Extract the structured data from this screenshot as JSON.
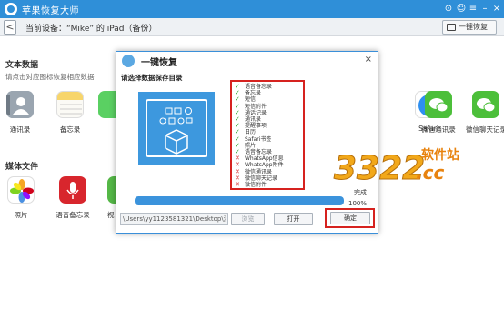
{
  "app": {
    "title": "苹果恢复大师"
  },
  "window_controls": {
    "icons": [
      "weibo-icon",
      "chat-icon",
      "menu-icon",
      "minimize-icon",
      "close-icon"
    ],
    "glyphs": [
      "⊙",
      "☺",
      "≡",
      "–",
      "×"
    ]
  },
  "subbar": {
    "back_glyph": "<",
    "device_label": "当前设备：“Mike” 的 iPad（备份）",
    "onekey_label": "一键恢复"
  },
  "sections": {
    "text_data": {
      "title": "文本数据",
      "hint": "请点击对应图标恢复相应数据"
    },
    "media_files": {
      "title": "媒体文件"
    }
  },
  "apps_row1": [
    {
      "label": "通讯录",
      "icon": "contacts-icon",
      "color": "#8e9aa6"
    },
    {
      "label": "备忘录",
      "icon": "notes-icon",
      "color": "#f7d56b"
    },
    {
      "label": "",
      "icon": "messages-icon",
      "color": "#5ad062"
    },
    {
      "label": "Safari",
      "icon": "safari-icon",
      "color": "#2e8ff0"
    },
    {
      "label": "微信通讯录",
      "icon": "wechat-contacts-icon",
      "color": "#4cbf3a"
    },
    {
      "label": "微信聊天记录",
      "icon": "wechat-chat-icon",
      "color": "#4cbf3a"
    }
  ],
  "apps_row2": [
    {
      "label": "照片",
      "icon": "photos-icon",
      "color": "#ffffff"
    },
    {
      "label": "语音备忘录",
      "icon": "voice-memo-icon",
      "color": "#d8262d"
    },
    {
      "label": "视",
      "icon": "video-icon",
      "color": "#55b847"
    }
  ],
  "dialog": {
    "title": "一键恢复",
    "close_glyph": "×",
    "prompt": "请选择数据保存目录",
    "items": [
      {
        "label": "语音备忘录",
        "ok": true
      },
      {
        "label": "备忘录",
        "ok": true
      },
      {
        "label": "短信",
        "ok": true
      },
      {
        "label": "短信附件",
        "ok": true
      },
      {
        "label": "通话记录",
        "ok": true
      },
      {
        "label": "通讯录",
        "ok": true
      },
      {
        "label": "提醒事项",
        "ok": true
      },
      {
        "label": "日历",
        "ok": true
      },
      {
        "label": "Safari书签",
        "ok": true
      },
      {
        "label": "照片",
        "ok": true
      },
      {
        "label": "语音备忘录",
        "ok": true
      },
      {
        "label": "WhatsApp信息",
        "ok": false
      },
      {
        "label": "WhatsApp附件",
        "ok": false
      },
      {
        "label": "微信通讯录",
        "ok": false
      },
      {
        "label": "微信聊天记录",
        "ok": false
      },
      {
        "label": "微信附件",
        "ok": false
      }
    ],
    "ok_glyph": "✓",
    "fail_glyph": "✕",
    "progress_value": 1.0,
    "status": "完成",
    "percent": "100%",
    "path": "\\Users\\yy1123581321\\Desktop\\测试",
    "browse_label": "浏览",
    "open_label": "打开",
    "confirm_label": "确定"
  },
  "watermark": {
    "number": "3322",
    "suffix": ".cc",
    "site": "软件站"
  }
}
